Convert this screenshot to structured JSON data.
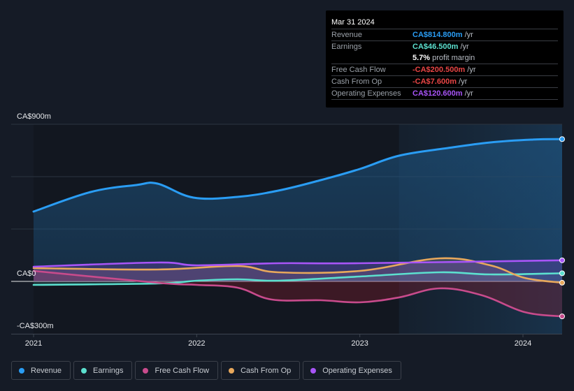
{
  "tooltip": {
    "date": "Mar 31 2024",
    "rows": [
      {
        "label": "Revenue",
        "value": "CA$814.800m",
        "unit": " /yr",
        "color": "#2a9df4"
      },
      {
        "label": "Earnings",
        "value": "CA$46.500m",
        "unit": " /yr",
        "color": "#5ce0cf"
      },
      {
        "label": "",
        "value": "5.7%",
        "unit": " profit margin",
        "color": "#ffffff"
      },
      {
        "label": "Free Cash Flow",
        "value": "-CA$200.500m",
        "unit": " /yr",
        "color": "#e84545"
      },
      {
        "label": "Cash From Op",
        "value": "-CA$7.600m",
        "unit": " /yr",
        "color": "#e84545"
      },
      {
        "label": "Operating Expenses",
        "value": "CA$120.600m",
        "unit": " /yr",
        "color": "#a855f7"
      }
    ]
  },
  "legend": [
    {
      "label": "Revenue",
      "color": "#2a9df4"
    },
    {
      "label": "Earnings",
      "color": "#5ce0cf"
    },
    {
      "label": "Free Cash Flow",
      "color": "#c84b8c"
    },
    {
      "label": "Cash From Op",
      "color": "#e8a85c"
    },
    {
      "label": "Operating Expenses",
      "color": "#a855f7"
    }
  ],
  "chart_data": {
    "type": "area",
    "title": "",
    "xlabel": "",
    "ylabel": "",
    "y_tick_labels": [
      "CA$900m",
      "CA$0",
      "-CA$300m"
    ],
    "y_ticks": [
      900,
      0,
      -300
    ],
    "x_tick_labels": [
      "2021",
      "2022",
      "2023",
      "2024"
    ],
    "x_ticks": [
      2021,
      2022,
      2023,
      2024
    ],
    "xlim": [
      2021,
      2024.24
    ],
    "ylim": [
      -300,
      900
    ],
    "highlight_from": 2023.24,
    "grid": true,
    "legend_position": "bottom",
    "series": [
      {
        "name": "Revenue",
        "color": "#2a9df4",
        "x": [
          2021,
          2021.35,
          2021.63,
          2021.76,
          2021.98,
          2022.25,
          2022.5,
          2022.76,
          2023,
          2023.24,
          2023.54,
          2023.8,
          2024.05,
          2024.24
        ],
        "values": [
          400,
          512,
          552,
          560,
          480,
          484,
          520,
          580,
          644,
          720,
          764,
          796,
          812,
          815
        ]
      },
      {
        "name": "Earnings",
        "color": "#5ce0cf",
        "x": [
          2021,
          2021.76,
          2022,
          2022.25,
          2022.5,
          2023,
          2023.49,
          2023.8,
          2024.24
        ],
        "values": [
          -20,
          -12,
          4,
          12,
          4,
          28,
          52,
          40,
          46.5
        ]
      },
      {
        "name": "Free Cash Flow",
        "color": "#c84b8c",
        "x": [
          2021,
          2021.76,
          2022,
          2022.25,
          2022.46,
          2022.76,
          2023,
          2023.24,
          2023.49,
          2023.75,
          2024.01,
          2024.24
        ],
        "values": [
          60,
          -8,
          -20,
          -36,
          -104,
          -108,
          -120,
          -92,
          -40,
          -80,
          -176,
          -200.5
        ]
      },
      {
        "name": "Cash From Op",
        "color": "#e8a85c",
        "x": [
          2021,
          2021.76,
          2022.25,
          2022.5,
          2023,
          2023.49,
          2023.8,
          2024.01,
          2024.24
        ],
        "values": [
          76,
          68,
          88,
          52,
          60,
          132,
          92,
          20,
          -7.6
        ]
      },
      {
        "name": "Operating Expenses",
        "color": "#a855f7",
        "x": [
          2021,
          2021.76,
          2022,
          2022.5,
          2023,
          2024.24
        ],
        "values": [
          84,
          108,
          92,
          104,
          104,
          120.6
        ]
      }
    ]
  }
}
